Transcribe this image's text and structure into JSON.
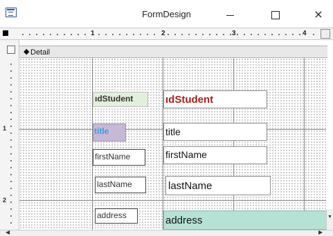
{
  "window": {
    "title": "FormDesign",
    "close_glyph": "×"
  },
  "ruler": {
    "horizontal_marks": [
      "1",
      "2",
      "3",
      "4"
    ],
    "vertical_marks": [
      "1",
      "2"
    ]
  },
  "section": {
    "arrow_glyph": "◆",
    "label": "Detail"
  },
  "controls": {
    "idstudent_label": "ıdStudent",
    "idstudent_field": "ıdStudent",
    "title_label": "title",
    "title_field": "title",
    "firstname_label": "firstName",
    "firstname_field": "firstName",
    "lastname_label": "lastName",
    "lastname_field": "lastName",
    "address_label": "address",
    "address_field": "address"
  },
  "scrollbar": {
    "down_glyph": "▼",
    "left_glyph": "◀",
    "right_glyph": "▶"
  },
  "icons": {
    "app": "form-design-icon",
    "minimize": "minimize-icon",
    "maximize": "maximize-icon",
    "close": "close-icon"
  },
  "colors": {
    "idstudent_label_bg": "#e2efda",
    "idstudent_field_text": "#b01c1c",
    "title_label_bg": "#c7b8d7",
    "title_label_text": "#2ca4e0",
    "address_field_bg": "#b4e3d5"
  }
}
